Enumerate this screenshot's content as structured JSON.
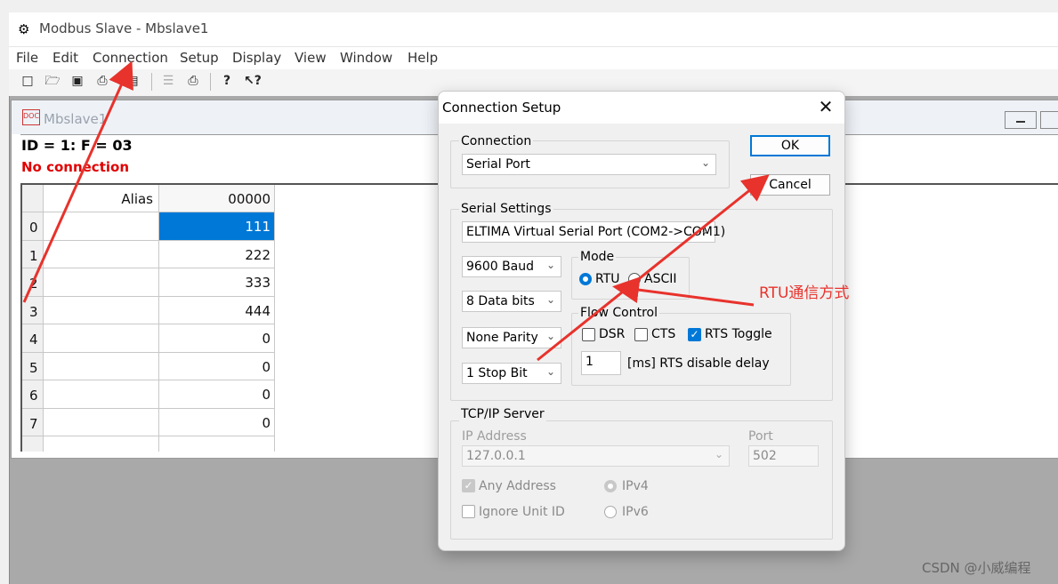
{
  "app": {
    "title": "Modbus Slave - Mbslave1",
    "menu": [
      "File",
      "Edit",
      "Connection",
      "Setup",
      "Display",
      "View",
      "Window",
      "Help"
    ],
    "toolbar_icons": [
      "new-icon",
      "open-icon",
      "save-icon",
      "print-icon",
      "window-icon",
      "connect-icon",
      "printer-icon",
      "help-icon",
      "context-help-icon"
    ]
  },
  "child": {
    "title": "Mbslave1",
    "id_line": "ID = 1: F = 03",
    "status": "No connection",
    "grid": {
      "col_alias": "Alias",
      "col_value": "00000",
      "rows": [
        {
          "index": "0",
          "value": "111"
        },
        {
          "index": "1",
          "value": "222"
        },
        {
          "index": "2",
          "value": "333"
        },
        {
          "index": "3",
          "value": "444"
        },
        {
          "index": "4",
          "value": "0"
        },
        {
          "index": "5",
          "value": "0"
        },
        {
          "index": "6",
          "value": "0"
        },
        {
          "index": "7",
          "value": "0"
        }
      ]
    }
  },
  "dialog": {
    "title": "Connection Setup",
    "ok": "OK",
    "cancel": "Cancel",
    "connection_label": "Connection",
    "connection_value": "Serial Port",
    "serial_label": "Serial Settings",
    "port_value": "ELTIMA Virtual Serial Port (COM2->COM1)",
    "baud_value": "9600 Baud",
    "databits_value": "8 Data bits",
    "parity_value": "None Parity",
    "stopbit_value": "1 Stop Bit",
    "mode_label": "Mode",
    "mode_rtu": "RTU",
    "mode_ascii": "ASCII",
    "flow_label": "Flow Control",
    "flow_dsr": "DSR",
    "flow_cts": "CTS",
    "flow_rts": "RTS Toggle",
    "rts_delay_value": "1",
    "rts_delay_label": "[ms] RTS disable delay",
    "tcp_label": "TCP/IP Server",
    "ip_label": "IP Address",
    "ip_value": "127.0.0.1",
    "port_label": "Port",
    "port_number": "502",
    "any_address": "Any Address",
    "ignore_unit": "Ignore Unit ID",
    "ipv4": "IPv4",
    "ipv6": "IPv6"
  },
  "annotation": "RTU通信方式",
  "watermark": "CSDN @小威编程",
  "colors": {
    "annotation_red": "#e8322c",
    "selection_blue": "#0078d7",
    "status_red": "#e00000"
  }
}
